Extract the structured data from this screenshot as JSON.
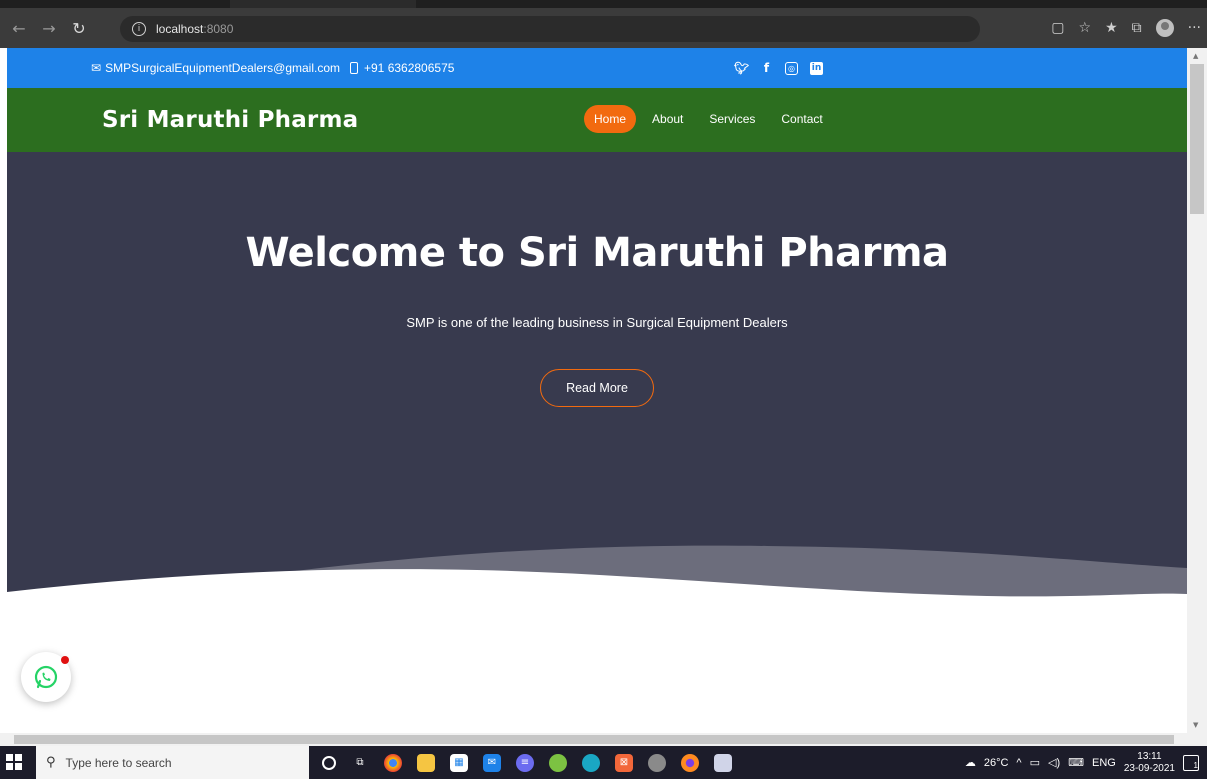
{
  "browser": {
    "url_host": "localhost",
    "url_port": ":8080",
    "back_icon": "arrow-left-icon",
    "forward_icon": "arrow-right-icon",
    "reload_icon": "reload-icon",
    "more_label": "···"
  },
  "topbar": {
    "email": "SMPSurgicalEquipmentDealers@gmail.com",
    "phone": "+91 6362806575",
    "social": [
      "twitter-icon",
      "facebook-icon",
      "instagram-icon",
      "linkedin-icon"
    ],
    "color": "#1e82e8"
  },
  "header": {
    "logo": "Sri Maruthi Pharma",
    "nav": [
      {
        "label": "Home",
        "active": true
      },
      {
        "label": "About",
        "active": false
      },
      {
        "label": "Services",
        "active": false
      },
      {
        "label": "Contact",
        "active": false
      }
    ],
    "color": "#2c6e1f",
    "accent": "#f26a0f"
  },
  "hero": {
    "title": "Welcome to Sri Maruthi Pharma",
    "subtitle": "SMP is one of the leading business in Surgical Equipment Dealers",
    "button": "Read More",
    "background": "#383a4e"
  },
  "whatsapp": {
    "icon": "whatsapp-icon",
    "has_notification": true
  },
  "taskbar": {
    "search_placeholder": "Type here to search",
    "weather": "26°C",
    "language": "ENG",
    "time": "13:11",
    "date": "23-09-2021",
    "notification_count": "1"
  }
}
